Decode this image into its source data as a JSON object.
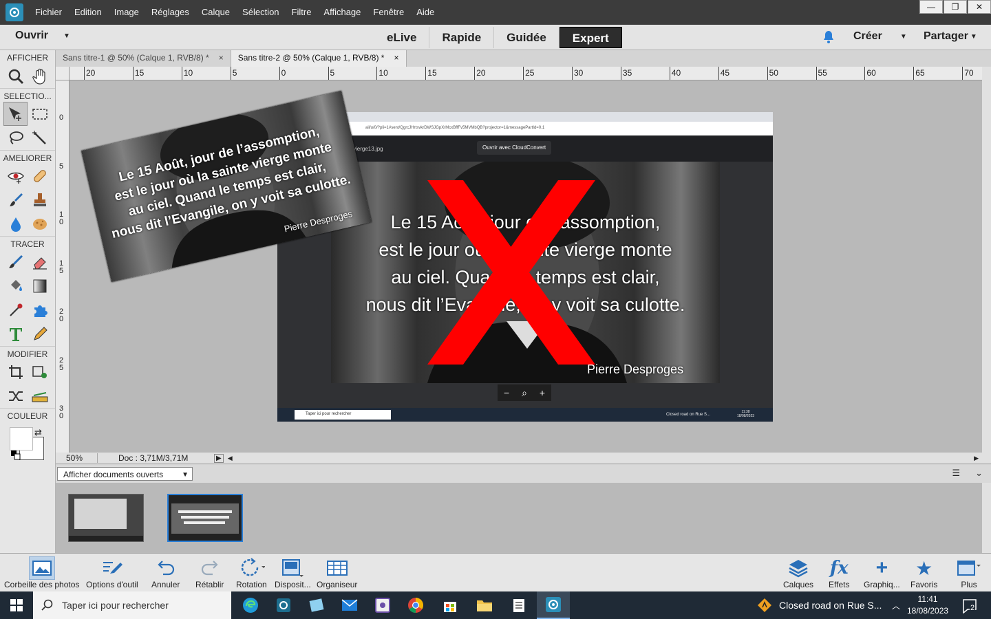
{
  "menubar": {
    "items": [
      "Fichier",
      "Edition",
      "Image",
      "Réglages",
      "Calque",
      "Sélection",
      "Filtre",
      "Affichage",
      "Fenêtre",
      "Aide"
    ]
  },
  "modebar": {
    "open_label": "Ouvrir",
    "tabs": [
      "eLive",
      "Rapide",
      "Guidée",
      "Expert"
    ],
    "active_tab": "Expert",
    "create_label": "Créer",
    "share_label": "Partager"
  },
  "toolbox": {
    "sections": [
      "AFFICHER",
      "SELECTIO...",
      "AMELIORER",
      "TRACER",
      "MODIFIER",
      "COULEUR"
    ]
  },
  "doc_tabs": [
    {
      "title": "Sans titre-1 @ 50% (Calque 1, RVB/8) *",
      "close": "×"
    },
    {
      "title": "Sans titre-2 @ 50% (Calque 1, RVB/8) *",
      "close": "×"
    }
  ],
  "ruler": {
    "h_ticks": [
      "20",
      "15",
      "10",
      "5",
      "0",
      "5",
      "10",
      "15",
      "20",
      "25",
      "30",
      "35",
      "40",
      "45",
      "50",
      "55",
      "60",
      "65",
      "70"
    ],
    "v_ticks": [
      "0",
      "5",
      "1\n0",
      "1\n5",
      "2\n0",
      "2\n5",
      "3\n0"
    ]
  },
  "status": {
    "zoom": "50%",
    "doc_info": "Doc : 3,71M/3,71M"
  },
  "canvas": {
    "quote_lines": [
      "Le 15 Août, jour de l’assomption,",
      "est le jour où la sainte vierge monte",
      "au ciel. Quand le temps est clair,",
      "nous dit l’Evangile, on y voit sa culotte."
    ],
    "signature": "Pierre Desproges",
    "inner_cloudconvert": "Ouvrir avec CloudConvert",
    "inner_filename": "vierge13.jpg",
    "inner_url": "ail/u/0/?pli=1#sent/QgrcJHrtsvkrDWSJGpXrMcxBffFv5MVMbQB?projector=1&messagePartId=0.1",
    "inner_taskbar_search": "Taper ici pour rechercher",
    "inner_road": "Closed road on Rue S...",
    "inner_time": "11:38",
    "inner_date": "18/08/2023"
  },
  "bin": {
    "select_label": "Afficher documents ouverts"
  },
  "actionbar": {
    "left": [
      "Corbeille des photos",
      "Options d'outil",
      "Annuler",
      "Rétablir",
      "Rotation",
      "Disposit...",
      "Organiseur"
    ],
    "right": [
      "Calques",
      "Effets",
      "Graphiq...",
      "Favoris",
      "Plus"
    ]
  },
  "taskbar": {
    "search_placeholder": "Taper ici pour rechercher",
    "news": "Closed road on Rue S...",
    "time": "11:41",
    "date": "18/08/2023",
    "notif_count": "2"
  },
  "colors": {
    "accent": "#2a7fd8",
    "menubar_bg": "#3c3c3c",
    "x_red": "#ff0000"
  }
}
